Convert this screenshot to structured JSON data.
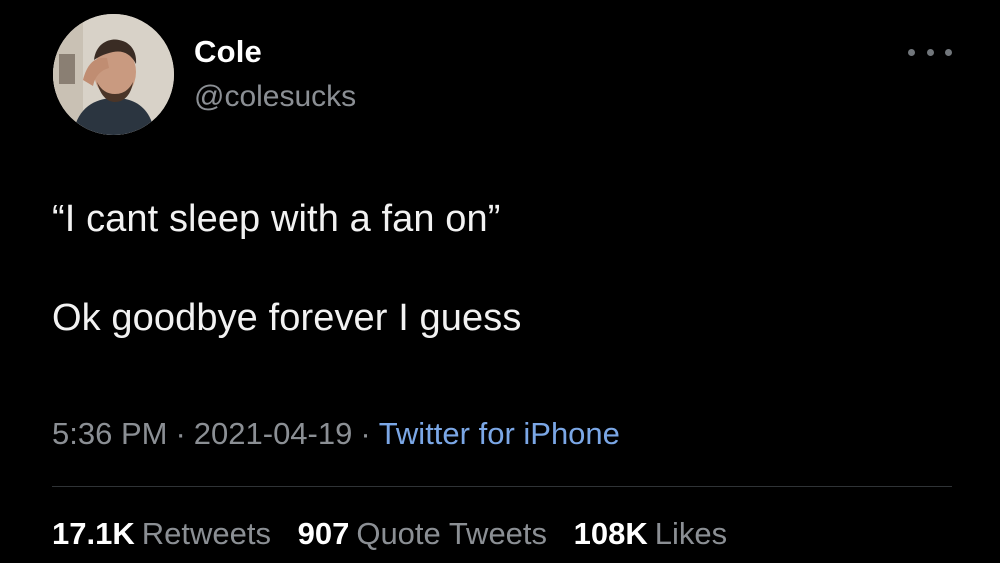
{
  "author": {
    "display_name": "Cole",
    "handle": "@colesucks"
  },
  "tweet": {
    "lines": [
      "“I cant sleep with a fan on”",
      "Ok goodbye forever I guess"
    ],
    "time": "5:36 PM",
    "date": "2021-04-19",
    "separator": "·",
    "source": "Twitter for iPhone"
  },
  "stats": {
    "retweets": {
      "count": "17.1K",
      "label": "Retweets"
    },
    "quote_tweets": {
      "count": "907",
      "label": "Quote Tweets"
    },
    "likes": {
      "count": "108K",
      "label": "Likes"
    }
  },
  "icons": {
    "more": "more-horizontal-icon"
  },
  "colors": {
    "background": "#000000",
    "primary_text": "#ffffff",
    "secondary_text": "#8b8f94",
    "link": "#7ba7e6",
    "divider": "#2f3336"
  }
}
